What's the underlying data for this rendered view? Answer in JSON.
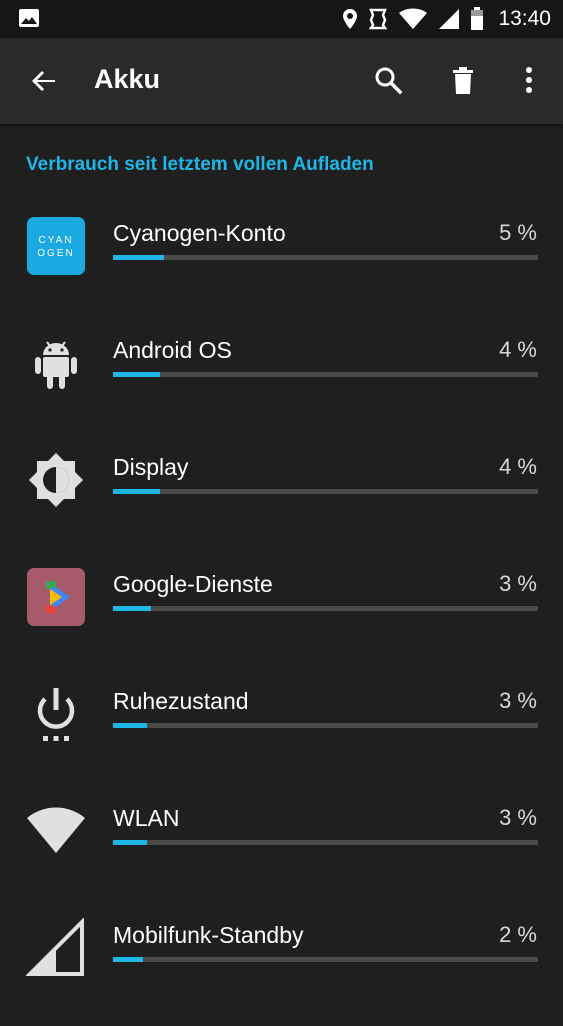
{
  "status_bar": {
    "time": "13:40",
    "left_icon": "image-notification-icon",
    "right_icons": [
      "location-icon",
      "nfc-icon",
      "wifi-icon",
      "signal-icon",
      "battery-icon"
    ]
  },
  "toolbar": {
    "title": "Akku",
    "back_icon": "arrow-back-icon",
    "search_icon": "search-icon",
    "delete_icon": "trash-icon",
    "more_icon": "more-vertical-icon"
  },
  "section_header": "Verbrauch seit letztem vollen Aufladen",
  "accent_color": "#1eb6e6",
  "items": [
    {
      "name": "Cyanogen-Konto",
      "percent_label": "5 %",
      "fill": 0.12,
      "icon": "cyanogen-icon",
      "icon_text_1": "CYAN",
      "icon_text_2": "OGEN"
    },
    {
      "name": "Android OS",
      "percent_label": "4 %",
      "fill": 0.11,
      "icon": "android-icon"
    },
    {
      "name": "Display",
      "percent_label": "4 %",
      "fill": 0.11,
      "icon": "brightness-icon"
    },
    {
      "name": "Google-Dienste",
      "percent_label": "3 %",
      "fill": 0.09,
      "icon": "google-play-services-icon"
    },
    {
      "name": "Ruhezustand",
      "percent_label": "3 %",
      "fill": 0.08,
      "icon": "power-idle-icon"
    },
    {
      "name": "WLAN",
      "percent_label": "3 %",
      "fill": 0.08,
      "icon": "wifi-icon"
    },
    {
      "name": "Mobilfunk-Standby",
      "percent_label": "2 %",
      "fill": 0.07,
      "icon": "cell-signal-icon"
    }
  ]
}
